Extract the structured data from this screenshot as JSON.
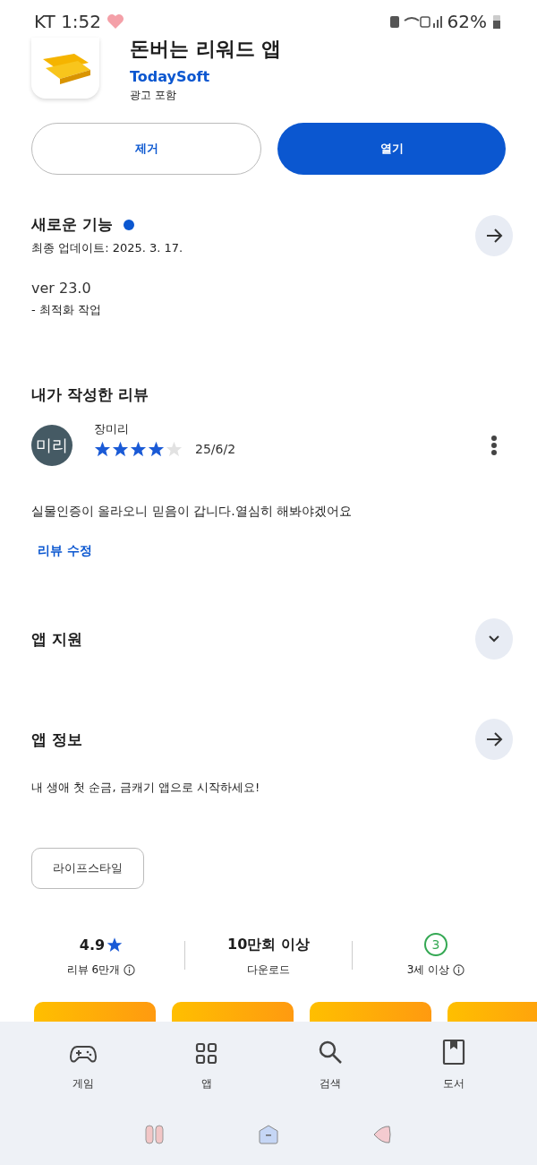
{
  "status_bar": {
    "carrier_time": "KT 1:52",
    "battery": "62%"
  },
  "app": {
    "title": "돈버는 리워드 앱",
    "developer": "TodaySoft",
    "note": "광고 포함"
  },
  "actions": [
    {
      "label": "제거",
      "kind": "outline"
    },
    {
      "label": "열기",
      "kind": "filled"
    }
  ],
  "whats_new": {
    "title": "새로운 기능",
    "new_dot": true,
    "updated": "최종 업데이트: 2025. 3. 17.",
    "version": "ver 23.0",
    "changes": "- 최적화 작업"
  },
  "my_review": {
    "title": "내가 작성한 리뷰",
    "avatar": "미리",
    "author": "장미리",
    "stars": 4,
    "date": "25/6/2",
    "text": "실물인증이 올라오니 믿음이 갑니다.열심히 해봐야겠어요",
    "edit": "리뷰 수정"
  },
  "sections": [
    {
      "title": "앱 지원",
      "kind": "expand"
    },
    {
      "title": "앱 정보",
      "kind": "open",
      "description": "내 생애 첫 순금, 금캐기 앱으로 시작하세요!"
    }
  ],
  "tag": "라이프스타일",
  "stats": [
    {
      "kind": "rating",
      "value": "4.9",
      "label": "리뷰 6만개",
      "info": true
    },
    {
      "kind": "plain",
      "value": "10만회 이상",
      "label": "다운로드",
      "info": false
    },
    {
      "kind": "age",
      "value": "3",
      "label": "3세 이상",
      "info": true
    }
  ],
  "bottom_nav": [
    {
      "label": "게임",
      "kind": "games"
    },
    {
      "label": "앱",
      "kind": "apps"
    },
    {
      "label": "검색",
      "kind": "search"
    },
    {
      "label": "도서",
      "kind": "books"
    }
  ]
}
